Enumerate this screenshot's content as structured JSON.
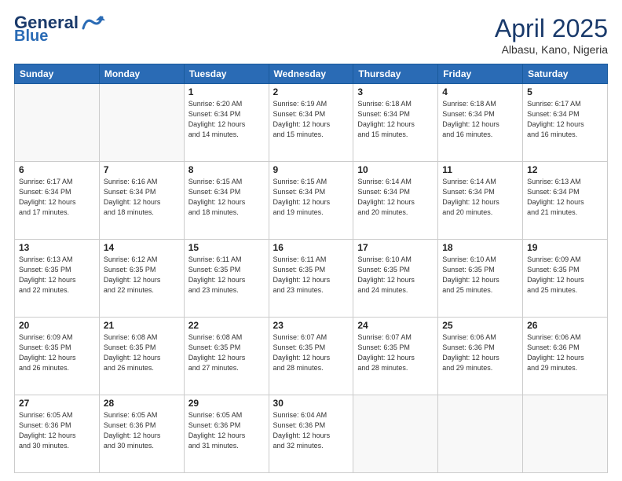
{
  "header": {
    "logo_line1": "General",
    "logo_line2": "Blue",
    "month": "April 2025",
    "location": "Albasu, Kano, Nigeria"
  },
  "weekdays": [
    "Sunday",
    "Monday",
    "Tuesday",
    "Wednesday",
    "Thursday",
    "Friday",
    "Saturday"
  ],
  "weeks": [
    [
      {
        "day": "",
        "info": ""
      },
      {
        "day": "",
        "info": ""
      },
      {
        "day": "1",
        "info": "Sunrise: 6:20 AM\nSunset: 6:34 PM\nDaylight: 12 hours\nand 14 minutes."
      },
      {
        "day": "2",
        "info": "Sunrise: 6:19 AM\nSunset: 6:34 PM\nDaylight: 12 hours\nand 15 minutes."
      },
      {
        "day": "3",
        "info": "Sunrise: 6:18 AM\nSunset: 6:34 PM\nDaylight: 12 hours\nand 15 minutes."
      },
      {
        "day": "4",
        "info": "Sunrise: 6:18 AM\nSunset: 6:34 PM\nDaylight: 12 hours\nand 16 minutes."
      },
      {
        "day": "5",
        "info": "Sunrise: 6:17 AM\nSunset: 6:34 PM\nDaylight: 12 hours\nand 16 minutes."
      }
    ],
    [
      {
        "day": "6",
        "info": "Sunrise: 6:17 AM\nSunset: 6:34 PM\nDaylight: 12 hours\nand 17 minutes."
      },
      {
        "day": "7",
        "info": "Sunrise: 6:16 AM\nSunset: 6:34 PM\nDaylight: 12 hours\nand 18 minutes."
      },
      {
        "day": "8",
        "info": "Sunrise: 6:15 AM\nSunset: 6:34 PM\nDaylight: 12 hours\nand 18 minutes."
      },
      {
        "day": "9",
        "info": "Sunrise: 6:15 AM\nSunset: 6:34 PM\nDaylight: 12 hours\nand 19 minutes."
      },
      {
        "day": "10",
        "info": "Sunrise: 6:14 AM\nSunset: 6:34 PM\nDaylight: 12 hours\nand 20 minutes."
      },
      {
        "day": "11",
        "info": "Sunrise: 6:14 AM\nSunset: 6:34 PM\nDaylight: 12 hours\nand 20 minutes."
      },
      {
        "day": "12",
        "info": "Sunrise: 6:13 AM\nSunset: 6:34 PM\nDaylight: 12 hours\nand 21 minutes."
      }
    ],
    [
      {
        "day": "13",
        "info": "Sunrise: 6:13 AM\nSunset: 6:35 PM\nDaylight: 12 hours\nand 22 minutes."
      },
      {
        "day": "14",
        "info": "Sunrise: 6:12 AM\nSunset: 6:35 PM\nDaylight: 12 hours\nand 22 minutes."
      },
      {
        "day": "15",
        "info": "Sunrise: 6:11 AM\nSunset: 6:35 PM\nDaylight: 12 hours\nand 23 minutes."
      },
      {
        "day": "16",
        "info": "Sunrise: 6:11 AM\nSunset: 6:35 PM\nDaylight: 12 hours\nand 23 minutes."
      },
      {
        "day": "17",
        "info": "Sunrise: 6:10 AM\nSunset: 6:35 PM\nDaylight: 12 hours\nand 24 minutes."
      },
      {
        "day": "18",
        "info": "Sunrise: 6:10 AM\nSunset: 6:35 PM\nDaylight: 12 hours\nand 25 minutes."
      },
      {
        "day": "19",
        "info": "Sunrise: 6:09 AM\nSunset: 6:35 PM\nDaylight: 12 hours\nand 25 minutes."
      }
    ],
    [
      {
        "day": "20",
        "info": "Sunrise: 6:09 AM\nSunset: 6:35 PM\nDaylight: 12 hours\nand 26 minutes."
      },
      {
        "day": "21",
        "info": "Sunrise: 6:08 AM\nSunset: 6:35 PM\nDaylight: 12 hours\nand 26 minutes."
      },
      {
        "day": "22",
        "info": "Sunrise: 6:08 AM\nSunset: 6:35 PM\nDaylight: 12 hours\nand 27 minutes."
      },
      {
        "day": "23",
        "info": "Sunrise: 6:07 AM\nSunset: 6:35 PM\nDaylight: 12 hours\nand 28 minutes."
      },
      {
        "day": "24",
        "info": "Sunrise: 6:07 AM\nSunset: 6:35 PM\nDaylight: 12 hours\nand 28 minutes."
      },
      {
        "day": "25",
        "info": "Sunrise: 6:06 AM\nSunset: 6:36 PM\nDaylight: 12 hours\nand 29 minutes."
      },
      {
        "day": "26",
        "info": "Sunrise: 6:06 AM\nSunset: 6:36 PM\nDaylight: 12 hours\nand 29 minutes."
      }
    ],
    [
      {
        "day": "27",
        "info": "Sunrise: 6:05 AM\nSunset: 6:36 PM\nDaylight: 12 hours\nand 30 minutes."
      },
      {
        "day": "28",
        "info": "Sunrise: 6:05 AM\nSunset: 6:36 PM\nDaylight: 12 hours\nand 30 minutes."
      },
      {
        "day": "29",
        "info": "Sunrise: 6:05 AM\nSunset: 6:36 PM\nDaylight: 12 hours\nand 31 minutes."
      },
      {
        "day": "30",
        "info": "Sunrise: 6:04 AM\nSunset: 6:36 PM\nDaylight: 12 hours\nand 32 minutes."
      },
      {
        "day": "",
        "info": ""
      },
      {
        "day": "",
        "info": ""
      },
      {
        "day": "",
        "info": ""
      }
    ]
  ]
}
